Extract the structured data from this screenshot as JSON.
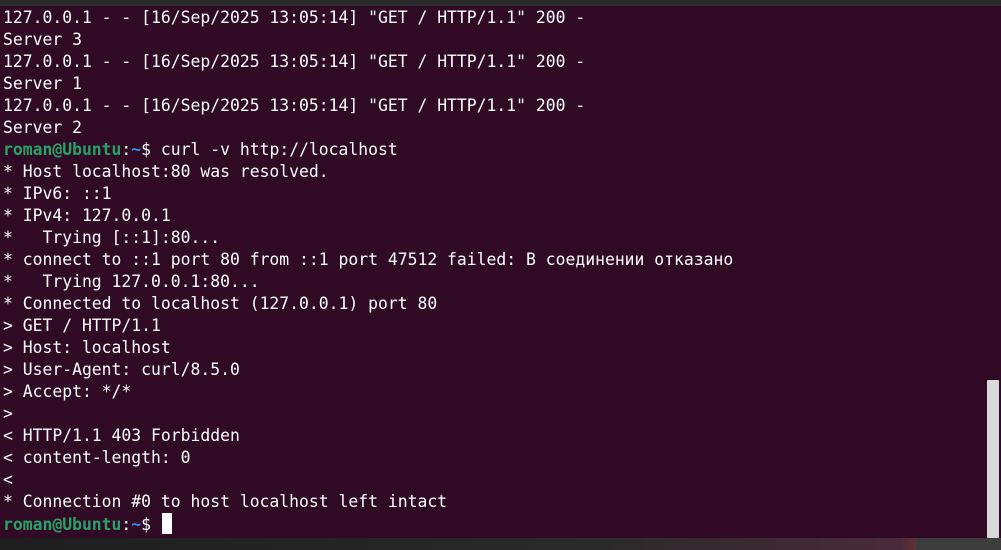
{
  "terminal": {
    "lines": [
      {
        "text": "127.0.0.1 - - [16/Sep/2025 13:05:14] \"GET / HTTP/1.1\" 200 -"
      },
      {
        "text": "Server 3"
      },
      {
        "text": "127.0.0.1 - - [16/Sep/2025 13:05:14] \"GET / HTTP/1.1\" 200 -"
      },
      {
        "text": "Server 1"
      },
      {
        "text": "127.0.0.1 - - [16/Sep/2025 13:05:14] \"GET / HTTP/1.1\" 200 -"
      },
      {
        "text": "Server 2"
      },
      {
        "prompt": {
          "user": "roman@Ubuntu",
          "sep": ":",
          "path": "~",
          "symbol": "$ "
        },
        "text": "curl -v http://localhost"
      },
      {
        "text": "* Host localhost:80 was resolved."
      },
      {
        "text": "* IPv6: ::1"
      },
      {
        "text": "* IPv4: 127.0.0.1"
      },
      {
        "text": "*   Trying [::1]:80..."
      },
      {
        "text": "* connect to ::1 port 80 from ::1 port 47512 failed: В соединении отказано"
      },
      {
        "text": "*   Trying 127.0.0.1:80..."
      },
      {
        "text": "* Connected to localhost (127.0.0.1) port 80"
      },
      {
        "text": "> GET / HTTP/1.1"
      },
      {
        "text": "> Host: localhost"
      },
      {
        "text": "> User-Agent: curl/8.5.0"
      },
      {
        "text": "> Accept: */*"
      },
      {
        "text": ">"
      },
      {
        "text": "< HTTP/1.1 403 Forbidden"
      },
      {
        "text": "< content-length: 0"
      },
      {
        "text": "<"
      },
      {
        "text": "* Connection #0 to host localhost left intact"
      },
      {
        "prompt": {
          "user": "roman@Ubuntu",
          "sep": ":",
          "path": "~",
          "symbol": "$ "
        },
        "text": "",
        "cursor": true
      }
    ]
  },
  "colors": {
    "background": "#300a24",
    "prompt_user": "#26a269",
    "prompt_path": "#3a86e6",
    "text": "#ffffff"
  }
}
